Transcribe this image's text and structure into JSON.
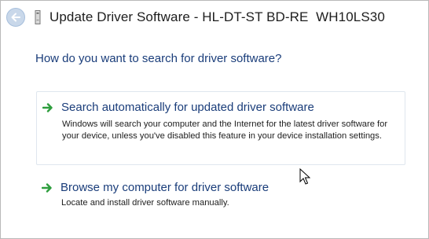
{
  "window": {
    "title": "Update Driver Software - HL-DT-ST BD-RE  WH10LS30",
    "back_icon": "back-arrow-icon",
    "device_icon": "optical-drive-icon"
  },
  "main": {
    "question": "How do you want to search for driver software?",
    "options": [
      {
        "title": "Search automatically for updated driver software",
        "description": "Windows will search your computer and the Internet for the latest driver software for your device, unless you've disabled this feature in your device installation settings.",
        "icon": "green-arrow-icon"
      },
      {
        "title": "Browse my computer for driver software",
        "description": "Locate and install driver software manually.",
        "icon": "green-arrow-icon"
      }
    ]
  },
  "colors": {
    "link_blue": "#1a3d7a",
    "arrow_green": "#2e9e3e",
    "back_button": "#c9d8ea"
  }
}
